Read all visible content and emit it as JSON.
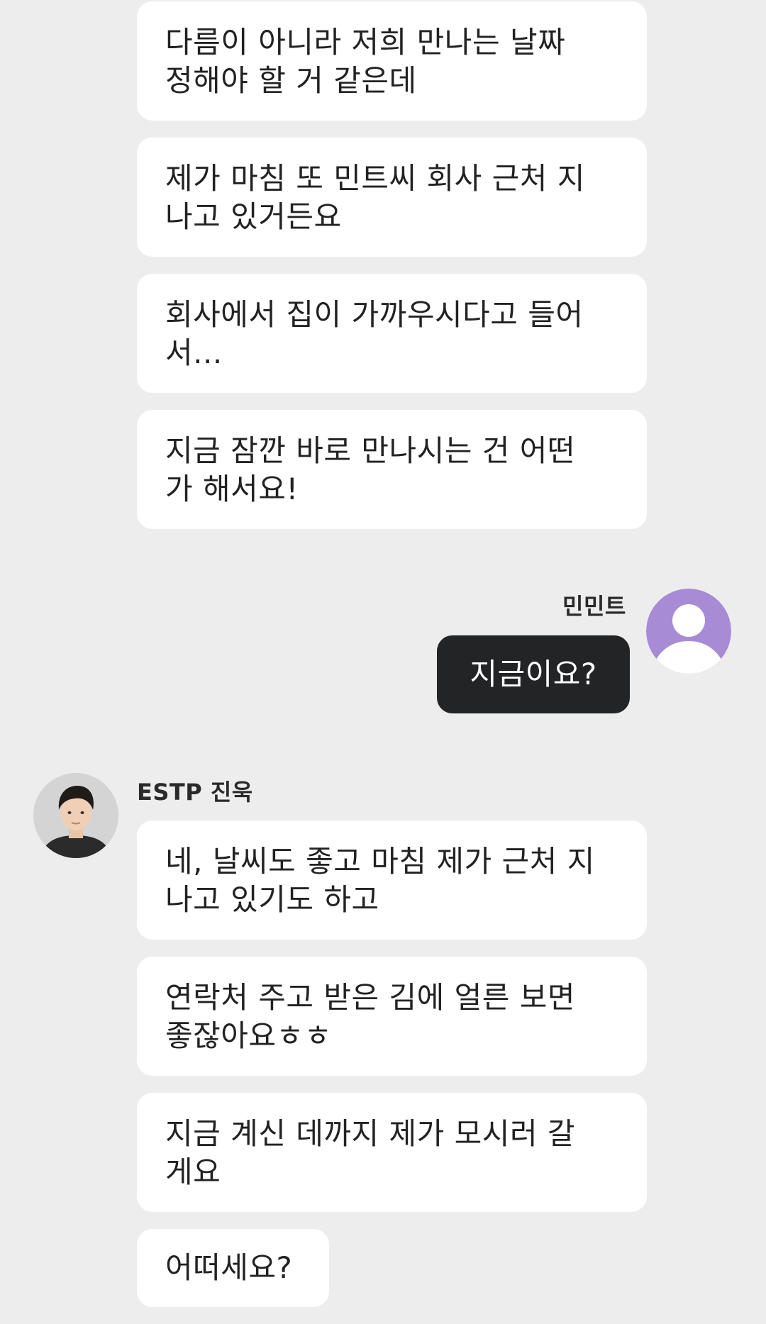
{
  "conversation": {
    "earlier_messages": [
      "다름이 아니라 저희 만나는 날짜\n정해야 할 거 같은데",
      "제가 마침 또 민트씨 회사 근처 지\n나고 있거든요",
      "회사에서 집이 가까우시다고 들어\n서...",
      "지금 잠깐 바로 만나시는 건 어떤\n가 해서요!"
    ],
    "me": {
      "name": "민민트",
      "avatar": "default-person-icon",
      "avatar_color": "#a78bd4",
      "message": "지금이요?"
    },
    "partner": {
      "name": "ESTP 진욱",
      "avatar": "profile-photo-man",
      "messages": [
        "네, 날씨도 좋고 마침 제가 근처 지\n나고 있기도 하고",
        "연락처 주고 받은 김에 얼른 보면\n좋잖아요ㅎㅎ",
        "지금 계신 데까지 제가 모시러 갈\n게요",
        "어떠세요?"
      ]
    }
  }
}
